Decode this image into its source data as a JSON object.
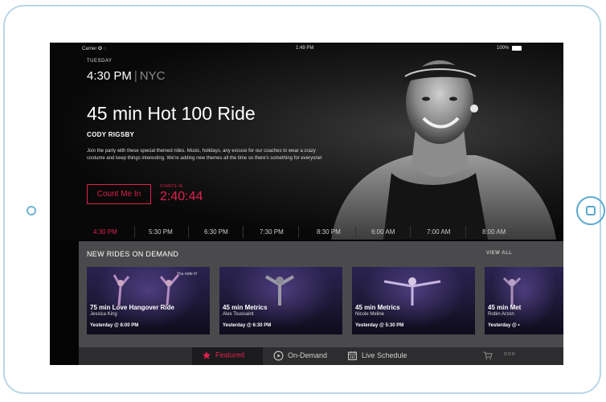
{
  "status_bar": {
    "carrier": "Carrier ✪ ◌",
    "time": "1:49 PM",
    "battery": "100%"
  },
  "header": {
    "day": "TUESDAY",
    "time": "4:30 PM",
    "separator": "|",
    "city": "NYC"
  },
  "featured_class": {
    "title": "45 min Hot 100 Ride",
    "instructor": "CODY RIGSBY",
    "description": "Join the party with these special themed rides. Music, holidays, any excuse for our coaches to wear a crazy costume and keep things interesting. We're adding new themes all the time so there's something for everyone!",
    "cta_label": "Count Me In",
    "starts_in_label": "STARTS IN",
    "countdown": "2:40:44"
  },
  "schedule_times": [
    "4:30 PM",
    "5:30 PM",
    "6:30 PM",
    "7:30 PM",
    "8:30 PM",
    "6:00 AM",
    "7:00 AM",
    "8:00 AM"
  ],
  "on_demand": {
    "title": "NEW RIDES ON DEMAND",
    "view_all": "VIEW ALL",
    "rides": [
      {
        "name": "75 min Love Hangover Ride",
        "instructor": "Jessica King",
        "when": "Yesterday @ 8:00 PM",
        "badge": "You rode it!"
      },
      {
        "name": "45 min Metrics",
        "instructor": "Alex Toussaint",
        "when": "Yesterday @ 6:30 PM"
      },
      {
        "name": "45 min Metrics",
        "instructor": "Nicole Meline",
        "when": "Yesterday @ 5:30 PM"
      },
      {
        "name": "45 min Met",
        "instructor": "Robin Arzon",
        "when": "Yesterday @ •"
      }
    ]
  },
  "tab_bar": {
    "featured": "Featured",
    "on_demand": "On-Demand",
    "live_schedule": "Live Schedule",
    "more": "ooo"
  },
  "colors": {
    "accent": "#e0204f",
    "frame": "#b9d6e6",
    "panel": "#4a4a4c"
  },
  "icons": [
    "star-icon",
    "play-circle-icon",
    "calendar-icon",
    "cart-icon",
    "more-icon",
    "home-button-icon"
  ]
}
